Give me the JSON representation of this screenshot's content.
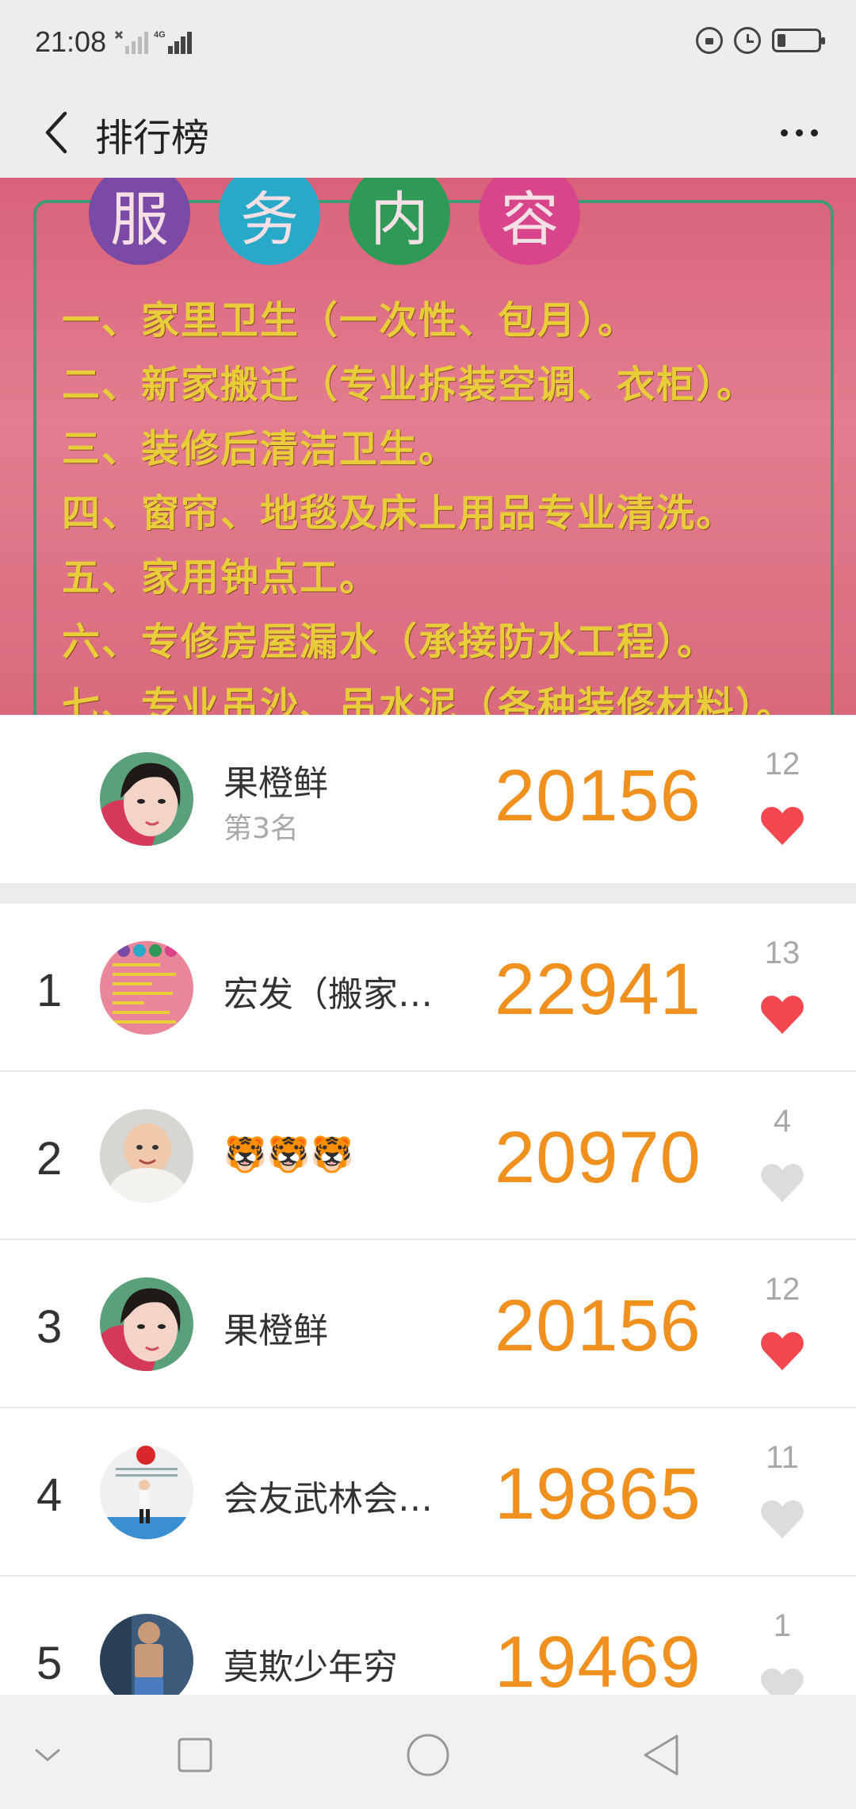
{
  "status_bar": {
    "time": "21:08",
    "network": "4G",
    "icons": [
      "signal-x-icon",
      "signal-4g-icon",
      "lock-rotation-icon",
      "alarm-icon",
      "battery-icon"
    ],
    "battery_level": 0.15
  },
  "header": {
    "back_icon": "chevron-left-icon",
    "title": "排行榜",
    "more_icon": "more-dots-icon"
  },
  "banner": {
    "circles": [
      {
        "char": "服",
        "color": "#7b4aa6"
      },
      {
        "char": "务",
        "color": "#28a9c8"
      },
      {
        "char": "内",
        "color": "#2f9a55"
      },
      {
        "char": "容",
        "color": "#d8458b"
      }
    ],
    "lines": [
      "一、家里卫生（一次性、包月）。",
      "二、新家搬迁（专业拆装空调、衣柜）。",
      "三、装修后清洁卫生。",
      "四、窗帘、地毯及床上用品专业清洗。",
      "五、家用钟点工。",
      "六、专修房屋漏水（承接防水工程）。",
      "七、专业吊沙、吊水泥（各种装修材料）。"
    ]
  },
  "my_rank": {
    "name": "果橙鲜",
    "rank_text": "第3名",
    "score": "20156",
    "likes": "12",
    "liked": true
  },
  "ranking": [
    {
      "rank": "1",
      "name": "宏发（搬家…",
      "score": "22941",
      "likes": "13",
      "liked": true
    },
    {
      "rank": "2",
      "name": "🐯🐯🐯",
      "score": "20970",
      "likes": "4",
      "liked": false
    },
    {
      "rank": "3",
      "name": "果橙鲜",
      "score": "20156",
      "likes": "12",
      "liked": true
    },
    {
      "rank": "4",
      "name": "会友武林会…",
      "score": "19865",
      "likes": "11",
      "liked": false
    },
    {
      "rank": "5",
      "name": "莫欺少年穷",
      "score": "19469",
      "likes": "1",
      "liked": false
    }
  ],
  "colors": {
    "score": "#f0901f",
    "heart_liked": "#f5474f",
    "heart_unliked": "#dcdcdc",
    "bar_bg": "#ededed"
  },
  "nav": {
    "icons": [
      "nav-down-icon",
      "nav-recents-icon",
      "nav-home-icon",
      "nav-back-icon"
    ]
  }
}
